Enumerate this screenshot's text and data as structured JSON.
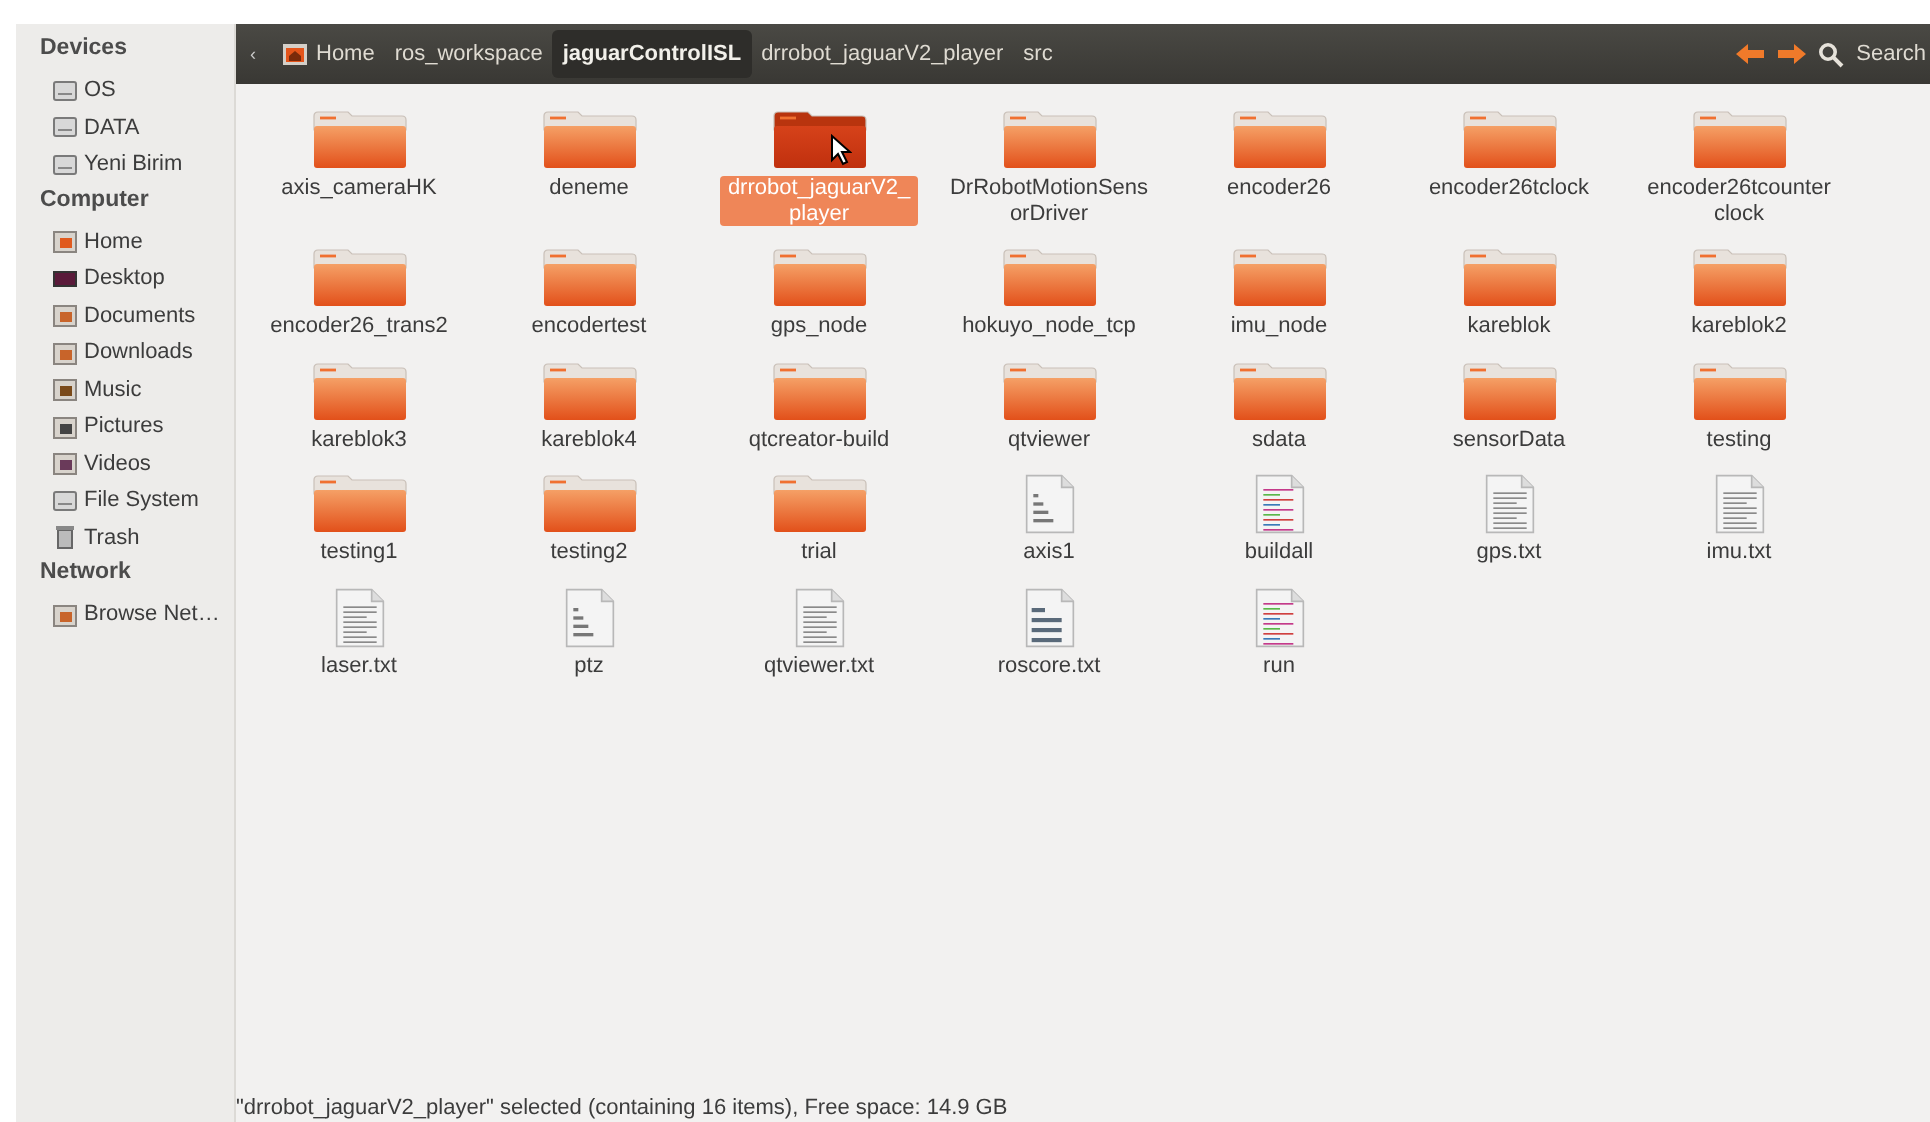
{
  "sidebar": {
    "sections": [
      {
        "title": "Devices",
        "items": [
          {
            "label": "OS"
          },
          {
            "label": "DATA"
          },
          {
            "label": "Yeni Birim"
          }
        ]
      },
      {
        "title": "Computer",
        "items": [
          {
            "label": "Home"
          },
          {
            "label": "Desktop"
          },
          {
            "label": "Documents"
          },
          {
            "label": "Downloads"
          },
          {
            "label": "Music"
          },
          {
            "label": "Pictures"
          },
          {
            "label": "Videos"
          },
          {
            "label": "File System"
          },
          {
            "label": "Trash"
          }
        ]
      },
      {
        "title": "Network",
        "items": [
          {
            "label": "Browse Net…"
          }
        ]
      }
    ]
  },
  "toolbar": {
    "back_scroll": "‹",
    "path": [
      {
        "label": "Home",
        "selected": false
      },
      {
        "label": "ros_workspace",
        "selected": false
      },
      {
        "label": "jaguarControlISL",
        "selected": true
      },
      {
        "label": "drrobot_jaguarV2_player",
        "selected": false
      },
      {
        "label": "src",
        "selected": false
      }
    ],
    "search": "Search"
  },
  "files": [
    {
      "name": "axis_cameraHK",
      "kind": "folder",
      "selected": false
    },
    {
      "name": "deneme",
      "kind": "folder",
      "selected": false
    },
    {
      "name": "drrobot_jaguarV2_player",
      "kind": "folder",
      "selected": true
    },
    {
      "name": "DrRobotMotionSensorDriver",
      "kind": "folder",
      "selected": false
    },
    {
      "name": "encoder26",
      "kind": "folder",
      "selected": false
    },
    {
      "name": "encoder26tclock",
      "kind": "folder",
      "selected": false
    },
    {
      "name": "encoder26tcounterclock",
      "kind": "folder",
      "selected": false
    },
    {
      "name": "encoder26_trans2",
      "kind": "folder",
      "selected": false
    },
    {
      "name": "encodertest",
      "kind": "folder",
      "selected": false
    },
    {
      "name": "gps_node",
      "kind": "folder",
      "selected": false
    },
    {
      "name": "hokuyo_node_tcp",
      "kind": "folder",
      "selected": false
    },
    {
      "name": "imu_node",
      "kind": "folder",
      "selected": false
    },
    {
      "name": "kareblok",
      "kind": "folder",
      "selected": false
    },
    {
      "name": "kareblok2",
      "kind": "folder",
      "selected": false
    },
    {
      "name": "kareblok3",
      "kind": "folder",
      "selected": false
    },
    {
      "name": "kareblok4",
      "kind": "folder",
      "selected": false
    },
    {
      "name": "qtcreator-build",
      "kind": "folder",
      "selected": false
    },
    {
      "name": "qtviewer",
      "kind": "folder",
      "selected": false
    },
    {
      "name": "sdata",
      "kind": "folder",
      "selected": false
    },
    {
      "name": "sensorData",
      "kind": "folder",
      "selected": false
    },
    {
      "name": "testing",
      "kind": "folder",
      "selected": false
    },
    {
      "name": "testing1",
      "kind": "folder",
      "selected": false
    },
    {
      "name": "testing2",
      "kind": "folder",
      "selected": false
    },
    {
      "name": "trial",
      "kind": "folder",
      "selected": false
    },
    {
      "name": "axis1",
      "kind": "binary",
      "selected": false
    },
    {
      "name": "buildall",
      "kind": "script",
      "selected": false
    },
    {
      "name": "gps.txt",
      "kind": "text",
      "selected": false
    },
    {
      "name": "imu.txt",
      "kind": "text",
      "selected": false
    },
    {
      "name": "laser.txt",
      "kind": "text",
      "selected": false
    },
    {
      "name": "ptz",
      "kind": "binary",
      "selected": false
    },
    {
      "name": "qtviewer.txt",
      "kind": "text",
      "selected": false
    },
    {
      "name": "roscore.txt",
      "kind": "preview",
      "selected": false
    },
    {
      "name": "run",
      "kind": "script",
      "selected": false
    }
  ],
  "status_bar": "\"drrobot_jaguarV2_player\" selected (containing 16 items), Free space: 14.9 GB"
}
